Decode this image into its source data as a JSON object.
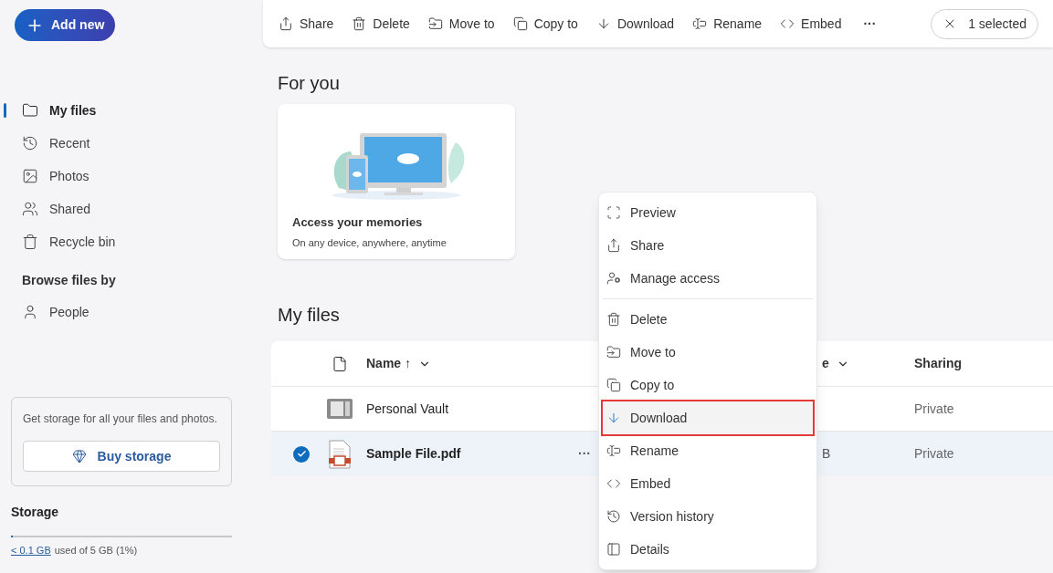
{
  "sidebar": {
    "add_button": "Add new",
    "nav": [
      {
        "label": "My files",
        "selected": true
      },
      {
        "label": "Recent",
        "selected": false
      },
      {
        "label": "Photos",
        "selected": false
      },
      {
        "label": "Shared",
        "selected": false
      },
      {
        "label": "Recycle bin",
        "selected": false
      }
    ],
    "browse_heading": "Browse files by",
    "browse": [
      {
        "label": "People",
        "selected": false
      }
    ],
    "promo": {
      "text": "Get storage for all your files and photos.",
      "button": "Buy storage"
    },
    "storage": {
      "title": "Storage",
      "level": 0.01,
      "used_link": "< 0.1 GB",
      "used_rest": "used of 5 GB (1%)"
    }
  },
  "toolbar": {
    "actions": [
      "Share",
      "Delete",
      "Move to",
      "Copy to",
      "Download",
      "Rename",
      "Embed"
    ],
    "more": "···",
    "selection": "1 selected"
  },
  "for_you": {
    "heading": "For you",
    "card": {
      "title": "Access your memories",
      "subtitle": "On any device, anywhere, anytime"
    }
  },
  "my_files": {
    "heading": "My files",
    "columns": [
      "Name ↑",
      "e",
      "Sharing"
    ],
    "rows": [
      {
        "kind": "vault",
        "name": "Personal Vault",
        "column_3": "",
        "sharing": "Private",
        "selected": false
      },
      {
        "kind": "pdf",
        "name": "Sample File.pdf",
        "column_3": "B",
        "sharing": "Private",
        "selected": true,
        "more": "···"
      }
    ]
  },
  "context_menu": {
    "groups": [
      [
        {
          "label": "Preview",
          "highlighted": false
        },
        {
          "label": "Share",
          "highlighted": false
        },
        {
          "label": "Manage access",
          "highlighted": false
        }
      ],
      [
        {
          "label": "Delete",
          "highlighted": false
        },
        {
          "label": "Move to",
          "highlighted": false
        },
        {
          "label": "Copy to",
          "highlighted": false
        },
        {
          "label": "Download",
          "highlighted": true
        },
        {
          "label": "Rename",
          "highlighted": false
        },
        {
          "label": "Embed",
          "highlighted": false
        },
        {
          "label": "Version history",
          "highlighted": false
        },
        {
          "label": "Details",
          "highlighted": false
        }
      ]
    ]
  }
}
